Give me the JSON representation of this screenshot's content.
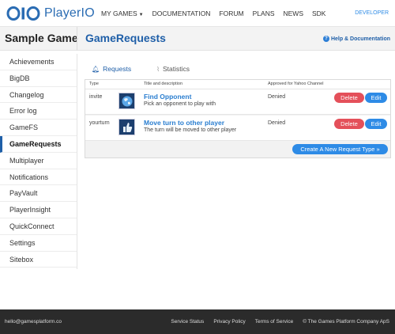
{
  "brand": {
    "name": "PlayerIO"
  },
  "nav": {
    "items": [
      "MY GAMES",
      "DOCUMENTATION",
      "FORUM",
      "PLANS",
      "NEWS",
      "SDK"
    ],
    "developer": "DEVELOPER"
  },
  "header": {
    "game_title": "Sample Game",
    "page_title": "GameRequests",
    "help": "Help & Documentation"
  },
  "sidebar": {
    "items": [
      "Achievements",
      "BigDB",
      "Changelog",
      "Error log",
      "GameFS",
      "GameRequests",
      "Multiplayer",
      "Notifications",
      "PayVault",
      "PlayerInsight",
      "QuickConnect",
      "Settings",
      "Sitebox"
    ],
    "active": "GameRequests"
  },
  "tabs": [
    "Requests",
    "Statistics"
  ],
  "table": {
    "headers": [
      "Type",
      "Title and description",
      "Approved for Yahoo Channel"
    ],
    "rows": [
      {
        "type": "invite",
        "title": "Find Opponent",
        "description": "Pick an opponent to play with",
        "approved": "Denied",
        "icon": "globe-icon"
      },
      {
        "type": "yourturn",
        "title": "Move turn to other player",
        "description": "The turn will be moved to other player",
        "approved": "Denied",
        "icon": "thumbs-up-icon"
      }
    ],
    "delete_label": "Delete",
    "edit_label": "Edit",
    "create_label": "Create A New Request Type »"
  },
  "footer": {
    "email": "hello@gamesplatform.co",
    "links": [
      "Service Status",
      "Privacy Policy",
      "Terms of Service",
      "© The Games Platform Company ApS"
    ]
  },
  "colors": {
    "accent": "#2e8be6",
    "title_blue": "#1f5fa8",
    "danger": "#e4505a",
    "footer": "#2b2b2b"
  }
}
